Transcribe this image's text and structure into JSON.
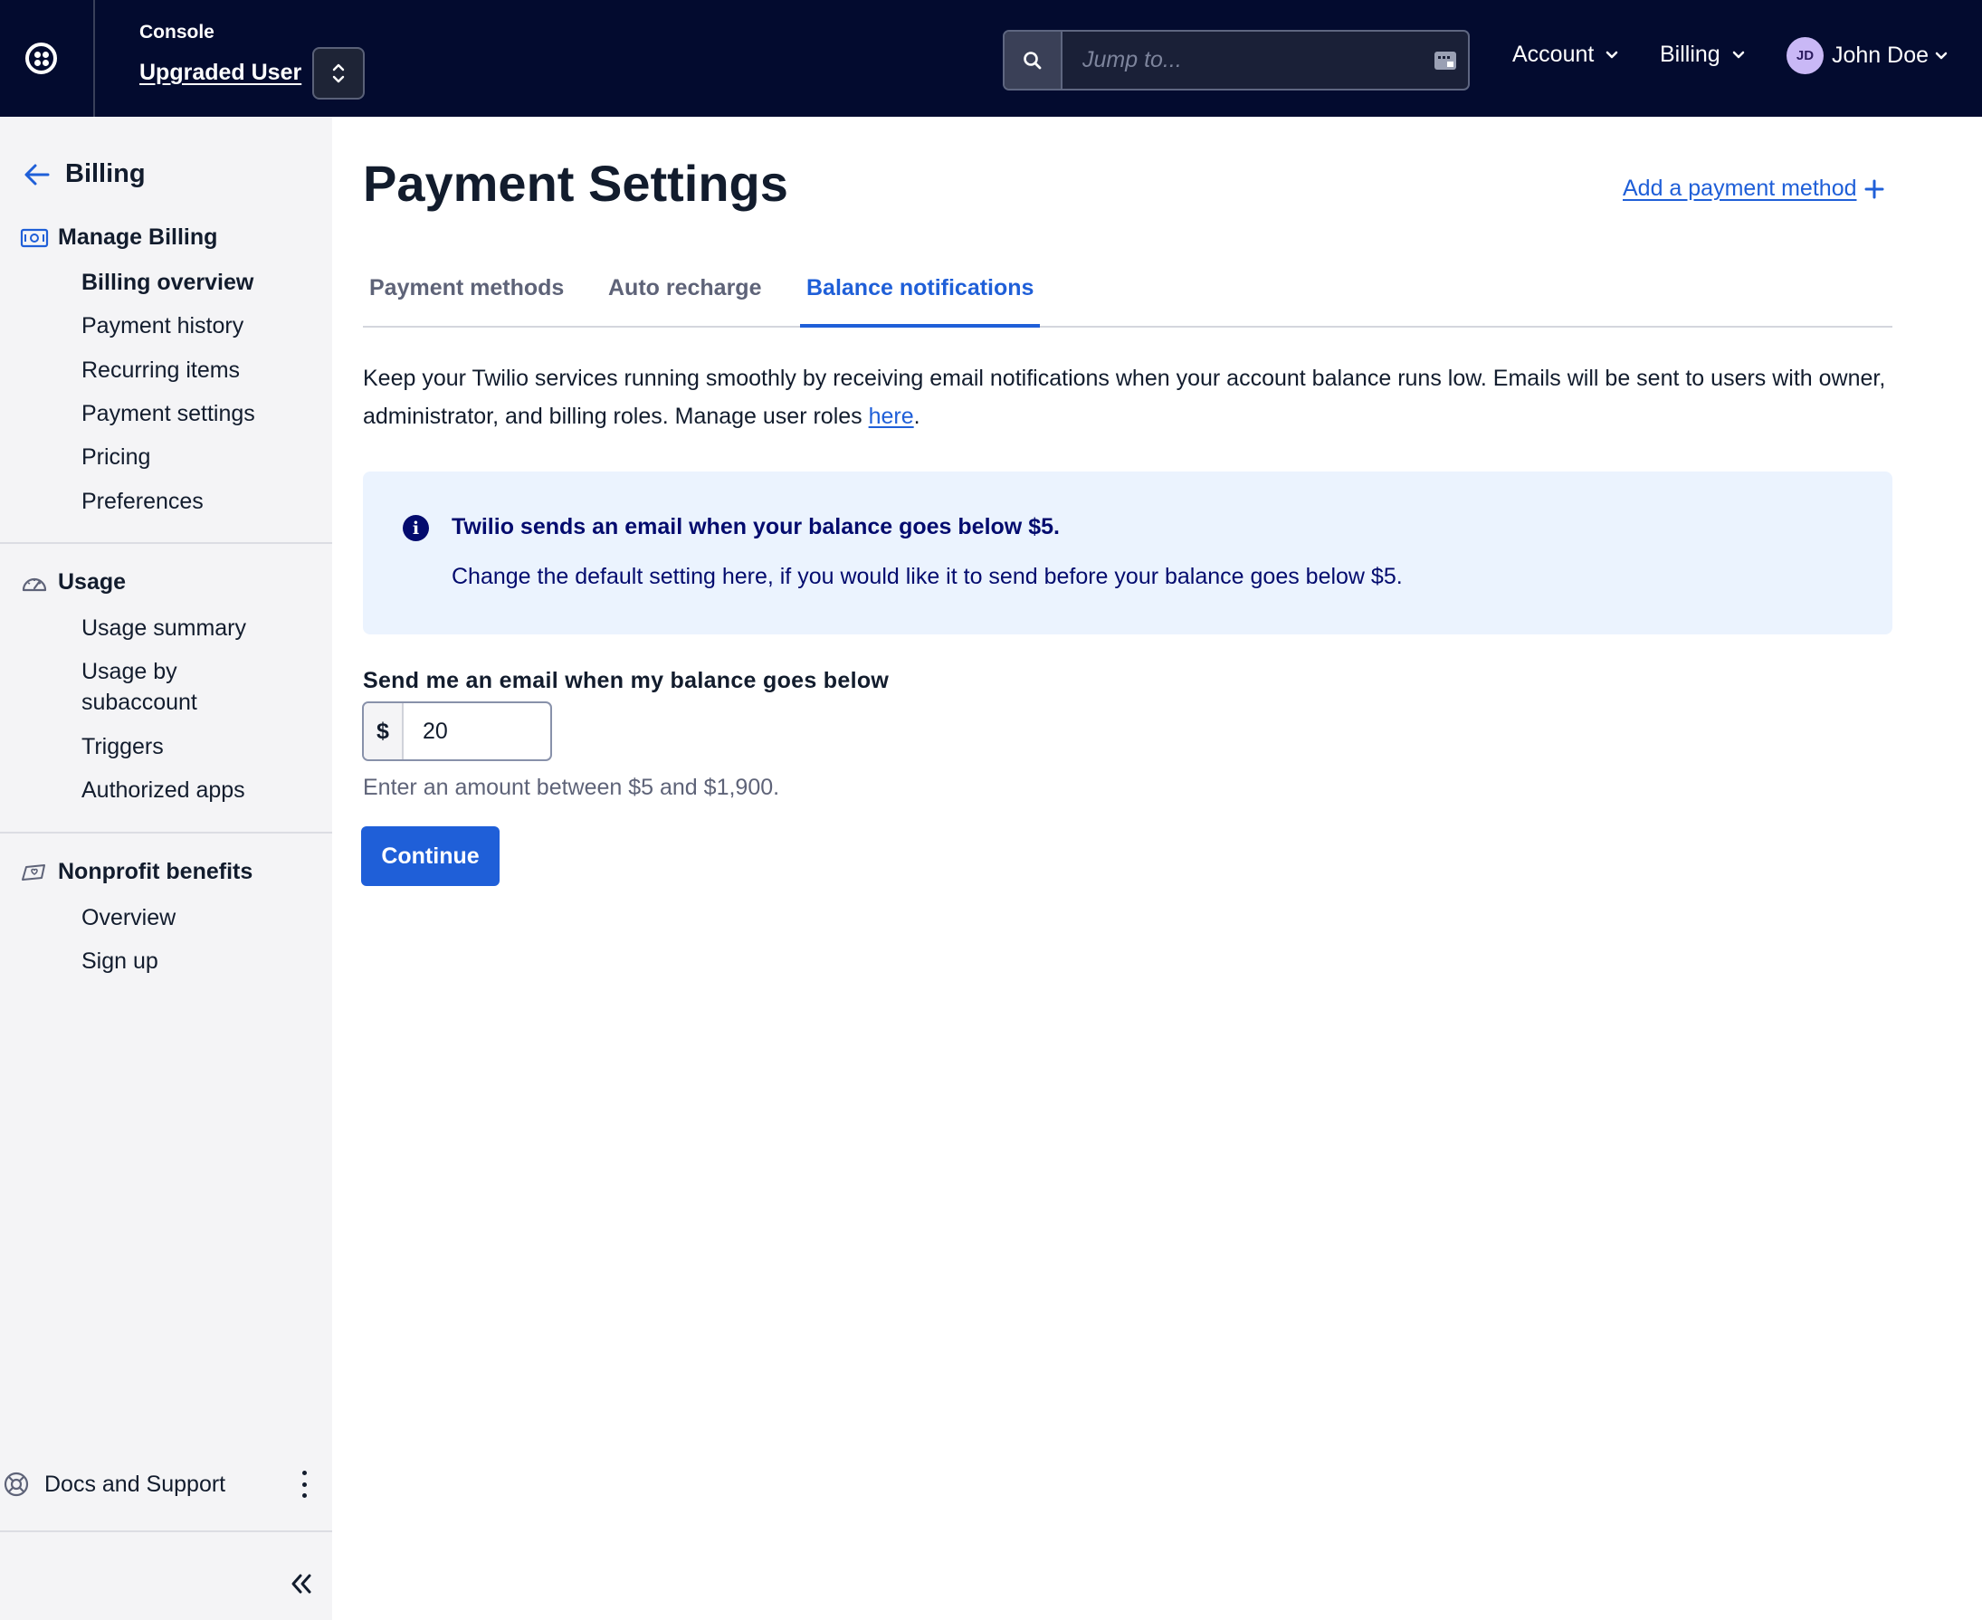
{
  "header": {
    "console_label": "Console",
    "account_name": "Upgraded User",
    "search": {
      "placeholder": "Jump to..."
    },
    "menus": {
      "account": "Account",
      "billing": "Billing"
    },
    "user": {
      "initials": "JD",
      "name": "John Doe"
    }
  },
  "sidebar": {
    "back_label": "Billing",
    "sections": [
      {
        "title": "Manage Billing",
        "items": [
          "Billing overview",
          "Payment history",
          "Recurring items",
          "Payment settings",
          "Pricing",
          "Preferences"
        ]
      },
      {
        "title": "Usage",
        "items": [
          "Usage summary",
          "Usage by subaccount",
          "Triggers",
          "Authorized apps"
        ]
      },
      {
        "title": "Nonprofit benefits",
        "items": [
          "Overview",
          "Sign up"
        ]
      }
    ],
    "active_item": "Billing overview",
    "footer": {
      "docs_label": "Docs and Support"
    }
  },
  "main": {
    "title": "Payment Settings",
    "add_payment_label": "Add a payment method",
    "tabs": [
      {
        "label": "Payment methods",
        "active": false
      },
      {
        "label": "Auto recharge",
        "active": false
      },
      {
        "label": "Balance notifications",
        "active": true
      }
    ],
    "intro_text": "Keep your Twilio services running smoothly by receiving email notifications when your account balance runs low. Emails will be sent to users with owner, administrator, and billing roles. Manage user roles ",
    "intro_link": "here",
    "intro_end": ".",
    "info": {
      "title": "Twilio sends an email when your balance goes below $5.",
      "body": "Change the default setting here, if you would like it to send before your balance goes below $5."
    },
    "form": {
      "label": "Send me an email when my balance goes below",
      "currency": "$",
      "value": "20",
      "helper": "Enter an amount between $5 and $1,900.",
      "submit_label": "Continue"
    }
  },
  "colors": {
    "topbar": "#030b2f",
    "accent": "#1f5fd8",
    "info_bg": "#ebf3fe",
    "info_text": "#030b6e",
    "sidebar_bg": "#f4f4f6"
  },
  "icons": {
    "logo": "twilio-logo-icon",
    "switcher": "chevron-up-down-icon",
    "search": "search-icon",
    "keyboard": "keyboard-shortcut-icon",
    "back": "arrow-left-icon",
    "manage_billing": "billing-icon",
    "usage": "gauge-icon",
    "nonprofit": "hand-heart-icon",
    "docs": "lifebuoy-icon",
    "kebab": "more-vertical-icon",
    "collapse": "chevron-double-left-icon",
    "add": "plus-icon",
    "info": "info-icon"
  }
}
